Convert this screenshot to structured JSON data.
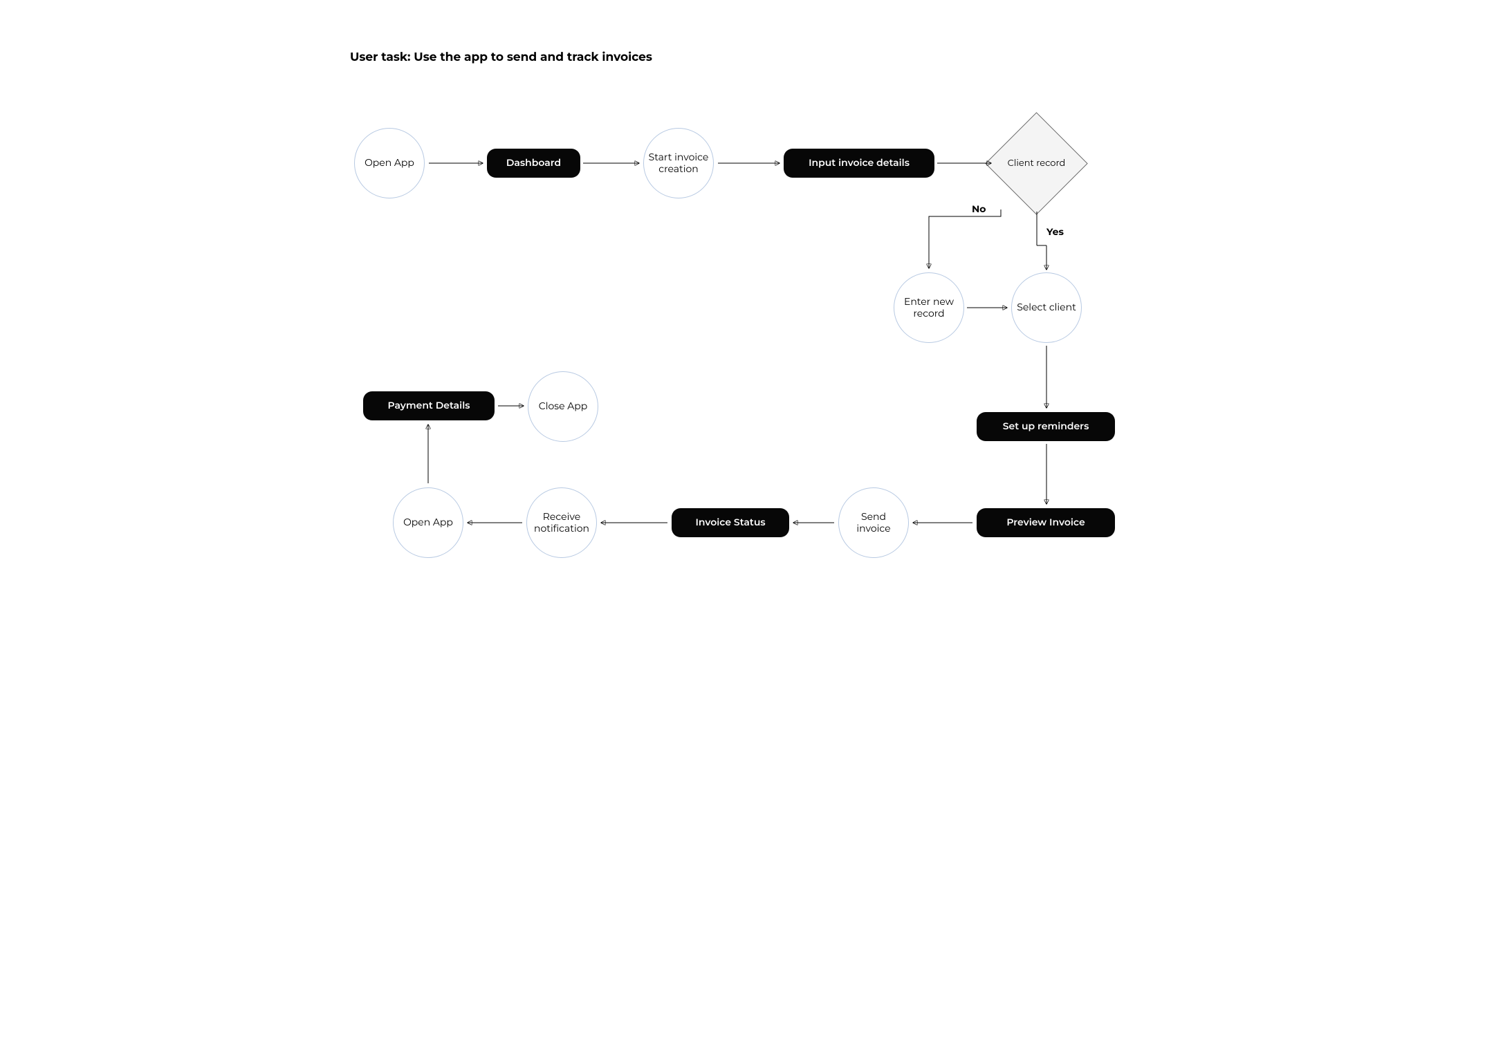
{
  "title": "User task: Use the app to send and track invoices",
  "nodes": {
    "open_app_1": "Open App",
    "dashboard": "Dashboard",
    "start_invoice": "Start invoice creation",
    "input_details": "Input invoice details",
    "client_record": "Client record",
    "enter_new_record": "Enter new record",
    "select_client": "Select client",
    "setup_reminders": "Set up reminders",
    "preview_invoice": "Preview Invoice",
    "send_invoice": "Send invoice",
    "invoice_status": "Invoice Status",
    "receive_notification": "Receive notification",
    "open_app_2": "Open App",
    "payment_details": "Payment Details",
    "close_app": "Close App"
  },
  "labels": {
    "no": "No",
    "yes": "Yes"
  }
}
